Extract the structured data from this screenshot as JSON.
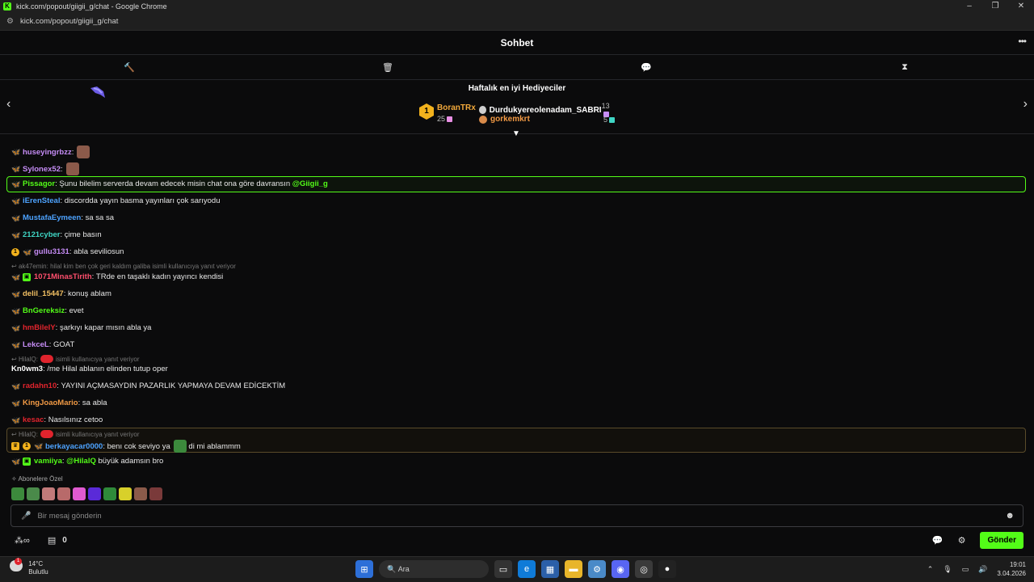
{
  "browser": {
    "title": "kick.com/popout/giigii_g/chat - Google Chrome",
    "url": "kick.com/popout/giigii_g/chat"
  },
  "header": {
    "title": "Sohbet"
  },
  "gifters": {
    "title": "Haftalık en iyi Hediyeciler",
    "first": {
      "rank": "1",
      "name": "BoranTRx",
      "count": "25"
    },
    "second": {
      "name": "Durdukyereolenadam_SABRI",
      "count": "13"
    },
    "third": {
      "name": "gorkemkrt",
      "count": "5"
    }
  },
  "messages": [
    {
      "user": "huseyingrbzz",
      "color": "#c58cf5",
      "text": ""
    },
    {
      "user": "Sylonex52",
      "color": "#c58cf5",
      "text": ""
    },
    {
      "user": "Pissagor",
      "color": "#53fc18",
      "text": "Şunu bilelim serverda devam edecek misin chat ona göre davransın",
      "mention": "@Giigii_g"
    },
    {
      "user": "iErenSteal",
      "color": "#4da3ff",
      "text": "discordda yayın basma yayınları çok sarıyodu"
    },
    {
      "user": "MustafaEymeen",
      "color": "#4da3ff",
      "text": "sa sa sa"
    },
    {
      "user": "2121cyber",
      "color": "#3fd6c5",
      "text": "çime basın"
    },
    {
      "user": "gullu3131",
      "color": "#c58cf5",
      "text": "abla seviliosun"
    },
    {
      "user": "1071MinasTirith",
      "color": "#ff4f6d",
      "text": "TRde en taşaklı kadın yayıncı kendisi"
    },
    {
      "user": "delil_15447",
      "color": "#f2c063",
      "text": "konuş ablam"
    },
    {
      "user": "BnGereksiz",
      "color": "#53fc18",
      "text": "evet"
    },
    {
      "user": "hmBileIY",
      "color": "#e0242d",
      "text": "şarkıyı kapar mısın abla ya"
    },
    {
      "user": "LekceL",
      "color": "#c58cf5",
      "text": "GOAT"
    },
    {
      "user": "Kn0wm3",
      "color": "#ffffff",
      "text": "/me Hilal ablanın elinden tutup oper"
    },
    {
      "user": "radahn10",
      "color": "#e0242d",
      "text": "YAYINI AÇMASAYDIN PAZARLIK YAPMAYA DEVAM EDİCEKTİM"
    },
    {
      "user": "KingJoaoMario",
      "color": "#f29a45",
      "text": "sa abla"
    },
    {
      "user": "kesac",
      "color": "#e0242d",
      "text": "Nasılsınız cetoo"
    },
    {
      "user": "berkayacar0000",
      "color": "#4da3ff",
      "text": "benı cok seviyo ya",
      "text2": "di mi ablammm"
    },
    {
      "user": "vamiiya",
      "color": "#53fc18",
      "text": "büyük adamsın bro",
      "mention": "@HilalQ"
    }
  ],
  "replies": [
    {
      "text": "ak47emin: hilal kim ben çok geri kaldım galiba isimli kullanıcıya yanıt veriyor"
    },
    {
      "prefix": "HilalQ:",
      "text": "isimli kullanıcıya yanıt veriyor"
    },
    {
      "prefix": "HilalQ:",
      "text": "isimli kullanıcıya yanıt veriyor"
    }
  ],
  "subs_label": "Abonelere Özel",
  "input": {
    "placeholder": "Bir mesaj gönderin"
  },
  "bottom": {
    "points": "0",
    "send_label": "Gönder"
  },
  "taskbar": {
    "temp": "14°C",
    "weather": "Bulutlu",
    "notif": "1",
    "search": "Ara",
    "time": "19:01",
    "date": "3.04.2026"
  },
  "colors": {
    "accent": "#53fc18",
    "gold": "#f2b21d"
  }
}
